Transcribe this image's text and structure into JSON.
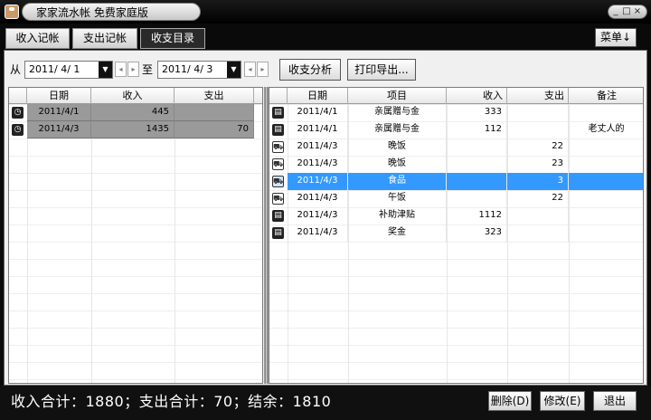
{
  "window": {
    "title": "家家流水帐 免费家庭版",
    "controls": [
      "_",
      "□",
      "×"
    ]
  },
  "tabs": [
    {
      "label": "收入记帐"
    },
    {
      "label": "支出记帐"
    },
    {
      "label": "收支目录"
    }
  ],
  "menu_button": "菜单↓",
  "filter": {
    "from_label": "从",
    "from_date": "2011/ 4/ 1",
    "to_label": "至",
    "to_date": "2011/ 4/ 3",
    "analyze_button": "收支分析",
    "print_button": "打印导出..."
  },
  "summary_table": {
    "columns": [
      "日期",
      "收入",
      "支出"
    ],
    "rows": [
      {
        "date": "2011/4/1",
        "income": "445",
        "expense": ""
      },
      {
        "date": "2011/4/3",
        "income": "1435",
        "expense": "70"
      }
    ]
  },
  "detail_table": {
    "columns": [
      "日期",
      "项目",
      "收入",
      "支出",
      "备注"
    ],
    "rows": [
      {
        "type": "income",
        "date": "2011/4/1",
        "item": "亲属赠与金",
        "income": "333",
        "expense": "",
        "note": ""
      },
      {
        "type": "income",
        "date": "2011/4/1",
        "item": "亲属赠与金",
        "income": "112",
        "expense": "",
        "note": "老丈人的"
      },
      {
        "type": "expense",
        "date": "2011/4/3",
        "item": "晚饭",
        "income": "",
        "expense": "22",
        "note": ""
      },
      {
        "type": "expense",
        "date": "2011/4/3",
        "item": "晚饭",
        "income": "",
        "expense": "23",
        "note": ""
      },
      {
        "type": "expense",
        "date": "2011/4/3",
        "item": "食品",
        "income": "",
        "expense": "3",
        "note": "",
        "selected": true
      },
      {
        "type": "expense",
        "date": "2011/4/3",
        "item": "午饭",
        "income": "",
        "expense": "22",
        "note": ""
      },
      {
        "type": "income",
        "date": "2011/4/3",
        "item": "补助津贴",
        "income": "1112",
        "expense": "",
        "note": ""
      },
      {
        "type": "income",
        "date": "2011/4/3",
        "item": "奖金",
        "income": "323",
        "expense": "",
        "note": ""
      }
    ]
  },
  "status": {
    "summary": "收入合计：1880；支出合计：70；结余：1810",
    "delete_button": "删除(D)",
    "edit_button": "修改(E)",
    "exit_button": "退出"
  }
}
